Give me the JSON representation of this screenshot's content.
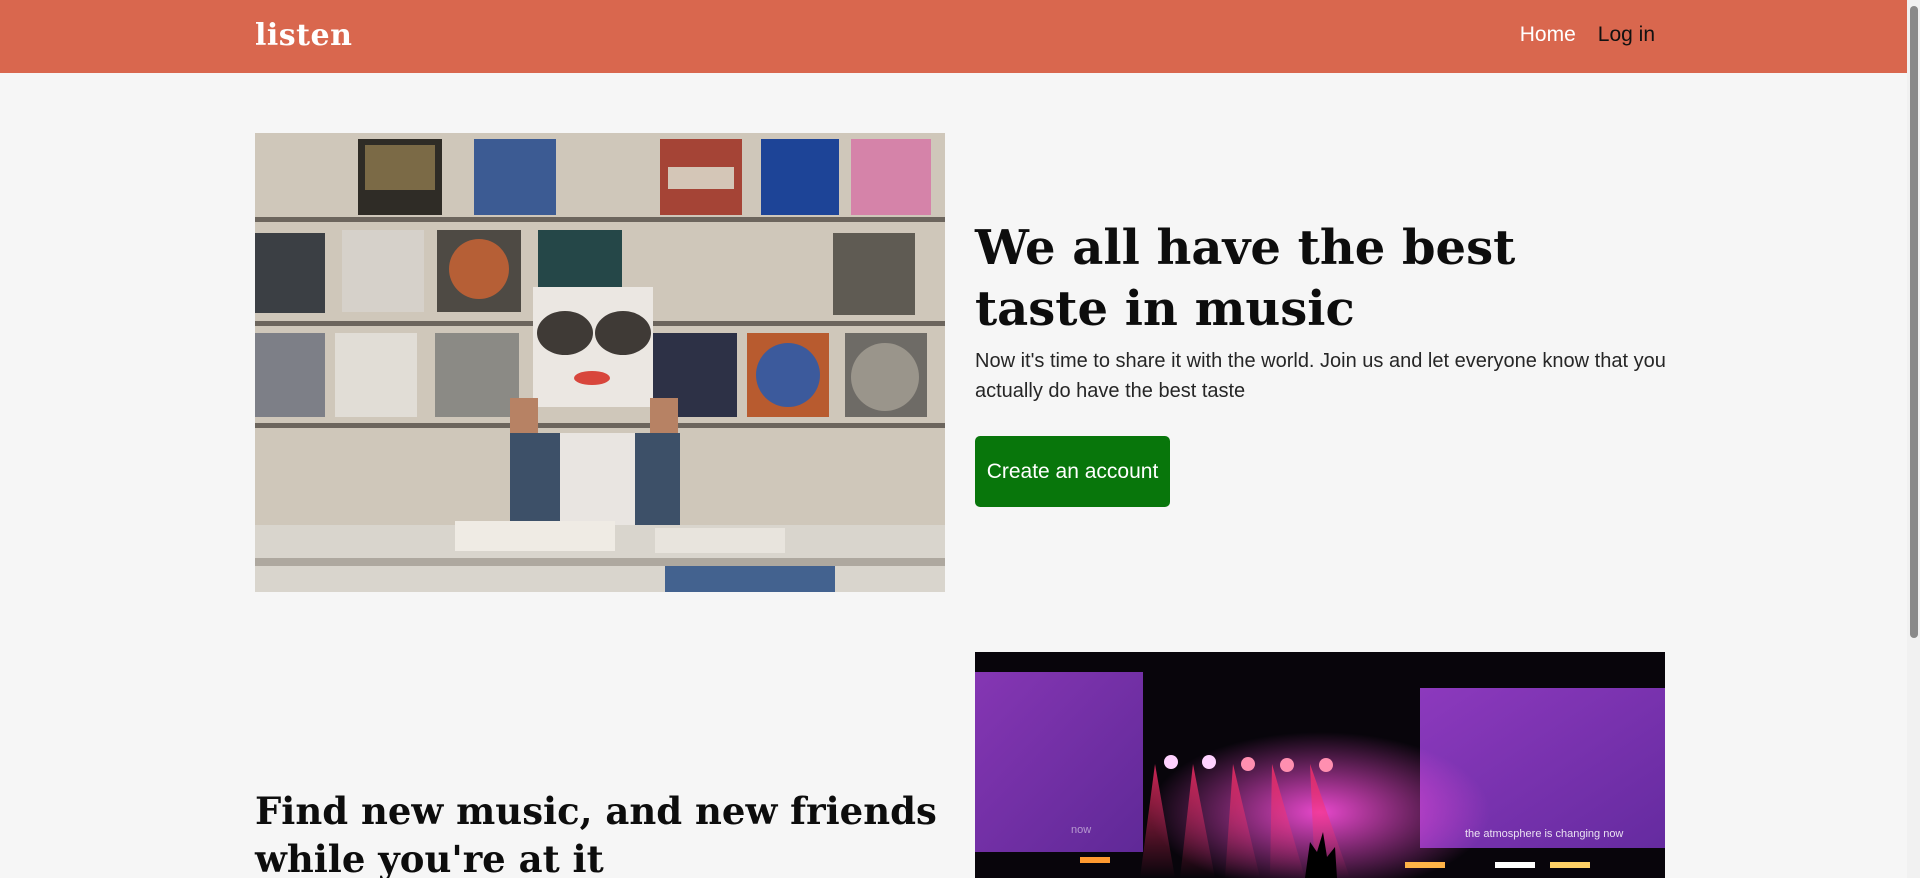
{
  "header": {
    "brand": "listen",
    "nav": [
      {
        "label": "Home"
      },
      {
        "label": "Log in"
      }
    ]
  },
  "hero": {
    "image_icon": "record-store-photo",
    "title": "We all have the best taste in music",
    "text": "Now it's time to share it with the world. Join us and let everyone know that you actually do have the best taste",
    "cta_label": "Create an account"
  },
  "feature": {
    "title": "Find new music, and new friends while you're at it",
    "image_icon": "concert-stage-photo",
    "image_caption": "the atmosphere is changing now",
    "image_caption_left": "now"
  },
  "colors": {
    "header_bg": "#d9674e",
    "page_bg": "#f6f6f6",
    "cta_bg": "#08760b"
  }
}
